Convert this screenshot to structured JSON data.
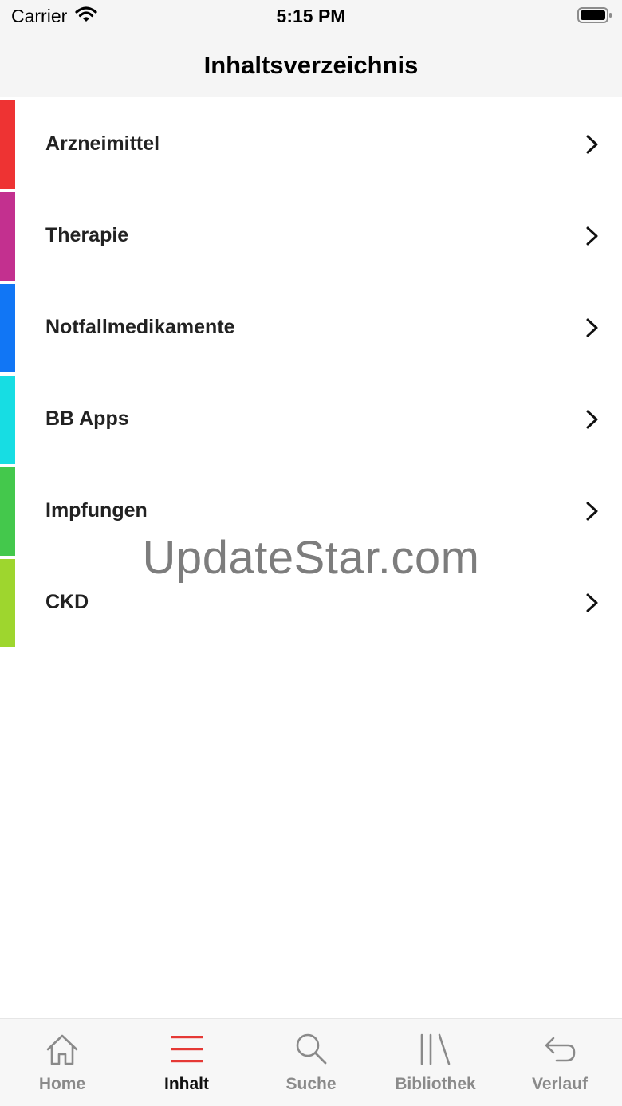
{
  "status": {
    "carrier": "Carrier",
    "time": "5:15 PM",
    "wifi_icon": "wifi-icon",
    "battery_icon": "battery-icon"
  },
  "nav": {
    "title": "Inhaltsverzeichnis"
  },
  "list": {
    "items": [
      {
        "label": "Arzneimittel",
        "color": "#ee3333"
      },
      {
        "label": "Therapie",
        "color": "#c3308f"
      },
      {
        "label": "Notfallmedikamente",
        "color": "#1176f5"
      },
      {
        "label": "BB Apps",
        "color": "#17dde3"
      },
      {
        "label": "Impfungen",
        "color": "#44c84c"
      },
      {
        "label": "CKD",
        "color": "#9ed62e"
      }
    ]
  },
  "watermark": {
    "text": "UpdateStar.com"
  },
  "tabs": {
    "items": [
      {
        "label": "Home",
        "icon": "home-icon",
        "active": false
      },
      {
        "label": "Inhalt",
        "icon": "menu-icon",
        "active": true
      },
      {
        "label": "Suche",
        "icon": "search-icon",
        "active": false
      },
      {
        "label": "Bibliothek",
        "icon": "library-icon",
        "active": false
      },
      {
        "label": "Verlauf",
        "icon": "undo-icon",
        "active": false
      }
    ]
  },
  "colors": {
    "accent": "#e53935",
    "inactive": "#8a8a8a",
    "bar_background": "#f5f5f5"
  }
}
